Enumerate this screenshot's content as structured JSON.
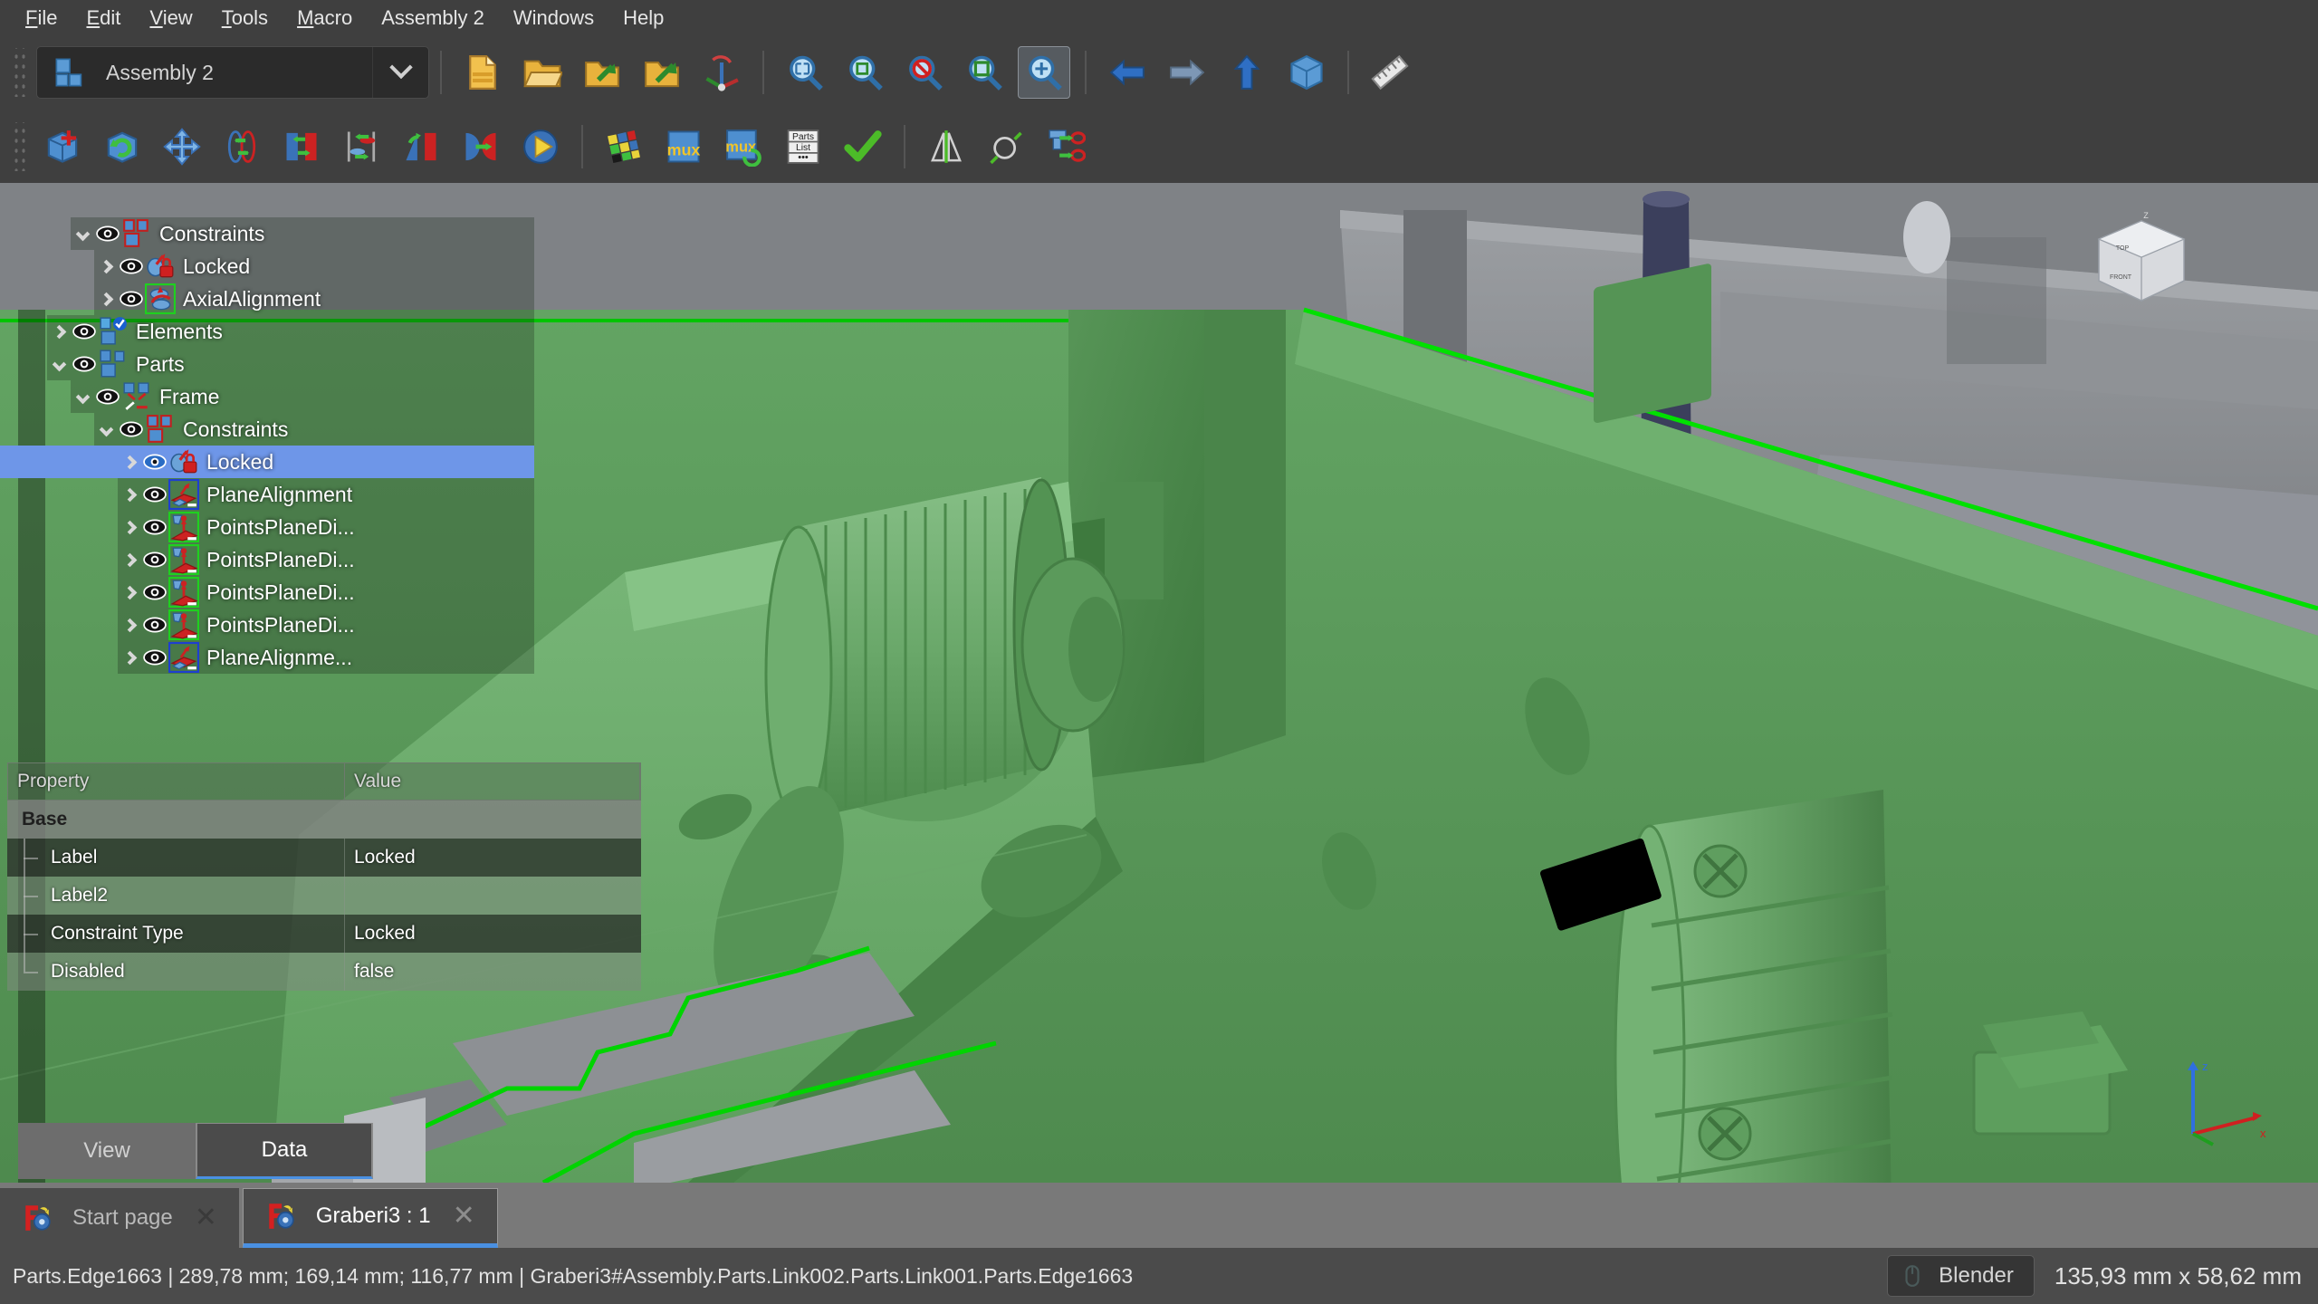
{
  "menubar": {
    "items": [
      {
        "label": "File",
        "accel": "F"
      },
      {
        "label": "Edit",
        "accel": "E"
      },
      {
        "label": "View",
        "accel": "V"
      },
      {
        "label": "Tools",
        "accel": "T"
      },
      {
        "label": "Macro",
        "accel": "M"
      },
      {
        "label": "Assembly 2",
        "accel": ""
      },
      {
        "label": "Windows",
        "accel": "W"
      },
      {
        "label": "Help",
        "accel": "H"
      }
    ]
  },
  "toolbar_main": {
    "workbench_selector": {
      "value": "Assembly 2",
      "icon": "assembly-workbench-icon",
      "arrow_icon": "chevron-down-icon"
    },
    "buttons": [
      {
        "name": "new-document-button",
        "icon": "new-document-icon"
      },
      {
        "name": "open-document-button",
        "icon": "open-folder-icon"
      },
      {
        "name": "save-document-button",
        "icon": "save-arrow-icon"
      },
      {
        "name": "save-as-button",
        "icon": "save-as-arrow-icon"
      },
      {
        "name": "refresh-button",
        "icon": "refresh-axis-icon"
      },
      {
        "name": "fit-all-button",
        "icon": "magnifier-fit-icon"
      },
      {
        "name": "fit-selection-button",
        "icon": "magnifier-selection-icon"
      },
      {
        "name": "zoom-clear-button",
        "icon": "magnifier-forbidden-icon"
      },
      {
        "name": "box-zoom-button",
        "icon": "magnifier-box-icon"
      },
      {
        "name": "zoom-active-button",
        "icon": "magnifier-active-icon",
        "active": true
      },
      {
        "name": "nav-back-button",
        "icon": "arrow-left-icon"
      },
      {
        "name": "nav-forward-button",
        "icon": "arrow-right-icon"
      },
      {
        "name": "nav-up-button",
        "icon": "arrow-up-icon"
      },
      {
        "name": "axonometric-view-button",
        "icon": "axonometric-cube-icon"
      },
      {
        "name": "measure-button",
        "icon": "ruler-icon"
      }
    ]
  },
  "toolbar_assembly": {
    "buttons": [
      {
        "name": "add-part-button",
        "icon": "cube-plus-icon"
      },
      {
        "name": "update-part-button",
        "icon": "cube-refresh-icon"
      },
      {
        "name": "move-part-button",
        "icon": "move-arrows-icon"
      },
      {
        "name": "axial-constraint-button",
        "icon": "axial-circles-icon"
      },
      {
        "name": "plane-constraint-button",
        "icon": "plane-align-icon"
      },
      {
        "name": "circular-edge-constraint-button",
        "icon": "circular-edge-icon"
      },
      {
        "name": "angle-constraint-button",
        "icon": "angle-constraint-icon"
      },
      {
        "name": "spherical-constraint-button",
        "icon": "spherical-constraint-icon"
      },
      {
        "name": "solve-constraints-button",
        "icon": "play-solve-icon"
      },
      {
        "name": "randomize-button",
        "icon": "rubiks-cube-icon"
      },
      {
        "name": "mux-assembly-button",
        "icon": "mux-icon",
        "label": "mux"
      },
      {
        "name": "mux-update-button",
        "icon": "mux-refresh-icon",
        "label": "mux"
      },
      {
        "name": "parts-list-button",
        "icon": "parts-list-icon",
        "label": "Parts List"
      },
      {
        "name": "accept-button",
        "icon": "green-check-icon"
      },
      {
        "name": "mirror-button",
        "icon": "mirror-plane-icon"
      },
      {
        "name": "circle-line-button",
        "icon": "circle-line-icon"
      },
      {
        "name": "bolt-constraint-button",
        "icon": "bolt-constraint-icon"
      }
    ]
  },
  "tree": {
    "rows": [
      {
        "label": "Constraints",
        "indent": 2,
        "expander": "down",
        "icon": "constraints-group-icon",
        "selected": false
      },
      {
        "label": "Locked",
        "indent": 3,
        "expander": "right",
        "icon": "locked-constraint-icon",
        "selected": false
      },
      {
        "label": "AxialAlignment",
        "indent": 3,
        "expander": "right",
        "icon": "axial-alignment-icon",
        "selected": false
      },
      {
        "label": "Elements",
        "indent": 1,
        "expander": "right",
        "icon": "elements-group-icon",
        "selected": false
      },
      {
        "label": "Parts",
        "indent": 1,
        "expander": "down",
        "icon": "parts-group-icon",
        "selected": false
      },
      {
        "label": "Frame",
        "indent": 2,
        "expander": "down",
        "icon": "frame-part-icon",
        "selected": false
      },
      {
        "label": "Constraints",
        "indent": 3,
        "expander": "down",
        "icon": "constraints-group-icon",
        "selected": false
      },
      {
        "label": "Locked",
        "indent": 4,
        "expander": "right",
        "icon": "locked-constraint-icon",
        "selected": true
      },
      {
        "label": "PlaneAlignment",
        "indent": 4,
        "expander": "right",
        "icon": "plane-alignment-icon",
        "selected": false
      },
      {
        "label": "PointsPlaneDi...",
        "indent": 4,
        "expander": "right",
        "icon": "points-plane-distance-icon",
        "selected": false
      },
      {
        "label": "PointsPlaneDi...",
        "indent": 4,
        "expander": "right",
        "icon": "points-plane-distance-icon",
        "selected": false
      },
      {
        "label": "PointsPlaneDi...",
        "indent": 4,
        "expander": "right",
        "icon": "points-plane-distance-icon",
        "selected": false
      },
      {
        "label": "PointsPlaneDi...",
        "indent": 4,
        "expander": "right",
        "icon": "points-plane-distance-icon",
        "selected": false
      },
      {
        "label": "PlaneAlignme...",
        "indent": 4,
        "expander": "right",
        "icon": "plane-alignment-icon",
        "selected": false
      }
    ]
  },
  "property_editor": {
    "headers": {
      "property": "Property",
      "value": "Value"
    },
    "groups": [
      {
        "name": "Base",
        "rows": [
          {
            "name": "Label",
            "value": "Locked"
          },
          {
            "name": "Label2",
            "value": ""
          },
          {
            "name": "Constraint Type",
            "value": "Locked"
          },
          {
            "name": "Disabled",
            "value": "false"
          }
        ]
      }
    ]
  },
  "panel_tabs": {
    "items": [
      {
        "label": "View",
        "selected": false
      },
      {
        "label": "Data",
        "selected": true
      }
    ]
  },
  "document_tabs": {
    "items": [
      {
        "label": "Start page",
        "active": false,
        "icon": "freecad-icon",
        "close_icon": "close-icon"
      },
      {
        "label": "Graberi3 : 1",
        "active": true,
        "icon": "freecad-icon",
        "close_icon": "close-icon"
      }
    ]
  },
  "statusbar": {
    "text": "Parts.Edge1663 | 289,78 mm; 169,14 mm; 116,77 mm | Graberi3#Assembly.Parts.Link002.Parts.Link001.Parts.Edge1663",
    "navigation_style": "Blender",
    "navigation_icon": "mouse-icon",
    "dimensions": "135,93 mm x 58,62 mm"
  },
  "navcube": {
    "top_label": "Z",
    "face_labels": [
      "TOP",
      "FRONT"
    ]
  },
  "colors": {
    "accent": "#4a90e2",
    "selection": "#6e96e8",
    "part_green": "#5d9e5d",
    "highlight_edge": "#00d400",
    "background_gray": "#7f8286",
    "toolbar_bg": "#3f3f3f",
    "statusbar_bg": "#4b4b4b"
  }
}
